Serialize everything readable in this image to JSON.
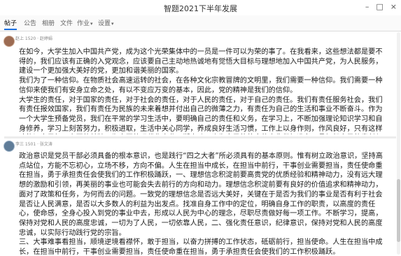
{
  "window": {
    "title": "智题2021下半年发展",
    "controls": {
      "minimize": "–",
      "maximize": "□",
      "close": "×"
    }
  },
  "tabs": [
    {
      "label": "帖子",
      "active": true
    },
    {
      "label": "公告"
    },
    {
      "label": "相册"
    },
    {
      "label": "文件"
    },
    {
      "label": "作业"
    },
    {
      "label": "设置"
    }
  ],
  "posts": [
    {
      "meta": "赵上 1520 · 赵婷娟",
      "paragraphs": [
        "在如今，大学生加入中国共产党，成为这个光荣集体中的一员是一件可以为荣的事了。在我看来，这些想法都是要不得的，我们应该有正确的入党观念，应该要自己主动地热诚地有觉悟大目标与理想地加入中国共产党，为人民服务，建设一个更加强大美好的党，更加和谐美丽的国家。",
        "我们为了一种信仰。在物质社会高速运转的社会，在各种文化宗教冒牌的文明里，我们需要一种信仰。我们需要一种信仰来使我们有安身立命之处，有以不变应万变的基本，因此，党的精神是我们的信仰。",
        "大学生的责任，对于国家的责任，对于社会的责任，对于人民的责任，对于自己的责任。我们有责任服务社会，我们有责任报效国家，我们有责任为民族的未来着想并付出自己的微薄之力，有责任为自己的生活和事业不断奋斗。作为一个大学生预备党员，我们在平常的学习生活中，要明确自己的责任和义务，在学习上，不断加强理论知识学习和自身修养，学习上刻苦努力，积极进取，生活中关心同学，养成良好生活习惯，工作上以身作则，作风良好，只有这样才能证自己打下牢固的基础，为中国的现代化事业不懈奋斗，也为自己的将来的人生做好准备，承担起自己的责任与义务。"
      ]
    },
    {
      "meta": "李三 1501 · 张文涛",
      "paragraphs": [
        "政治意识是党员干部必须具备的根本意识，也是践行“四之大者”所必须具有的基本原则。惟有树立政治意识，坚持高点站位，方能不忘初心，立场不移，方向不偏。人生在担当中成长，在担当中前行，干事创业需要担当，责任使命重在担当，勇于承担责任会使我们的工作积极踊跃，一、理想信念积淀前要高贵党的优质经验和精神动力，没有远大理想的激励和引领，再美丽的事业也可能会失去前行的方向和动力。理想信念积淀前要有良好的价值追求和精神动力，面对了政策和任务，为何而去的问题。一致党的理想信念是否远大美好，关键在于是否为我们的事业是否有利于社会是否让人民满意，是否以大多数人的利益为出发点。找准自身工作中的定位，明确自身工作的职责，以高度的责任心，使命感，全身心投入到党的事业中去，形成以人民为中心的理念，尽职尽责做好每一项工作。不断学习，提高，保持对党和人民的高度忠诚，一切为了人民，一切依靠人民，二、强化责任意识，纪律意识，保持对党和人民的高度忠诚，以实际行动践行党的宗旨。",
        "三、大事难事看担当，顺境逆境看襟怀，敢于担当，以奋力拼搏的工作状态，砥砺前行，担当使命。人生在担当中成长，在担当中前行，干事创业需要担当，责任使命重在担当，勇于承担责任会使我们的工作积极踊跃。"
      ]
    }
  ]
}
